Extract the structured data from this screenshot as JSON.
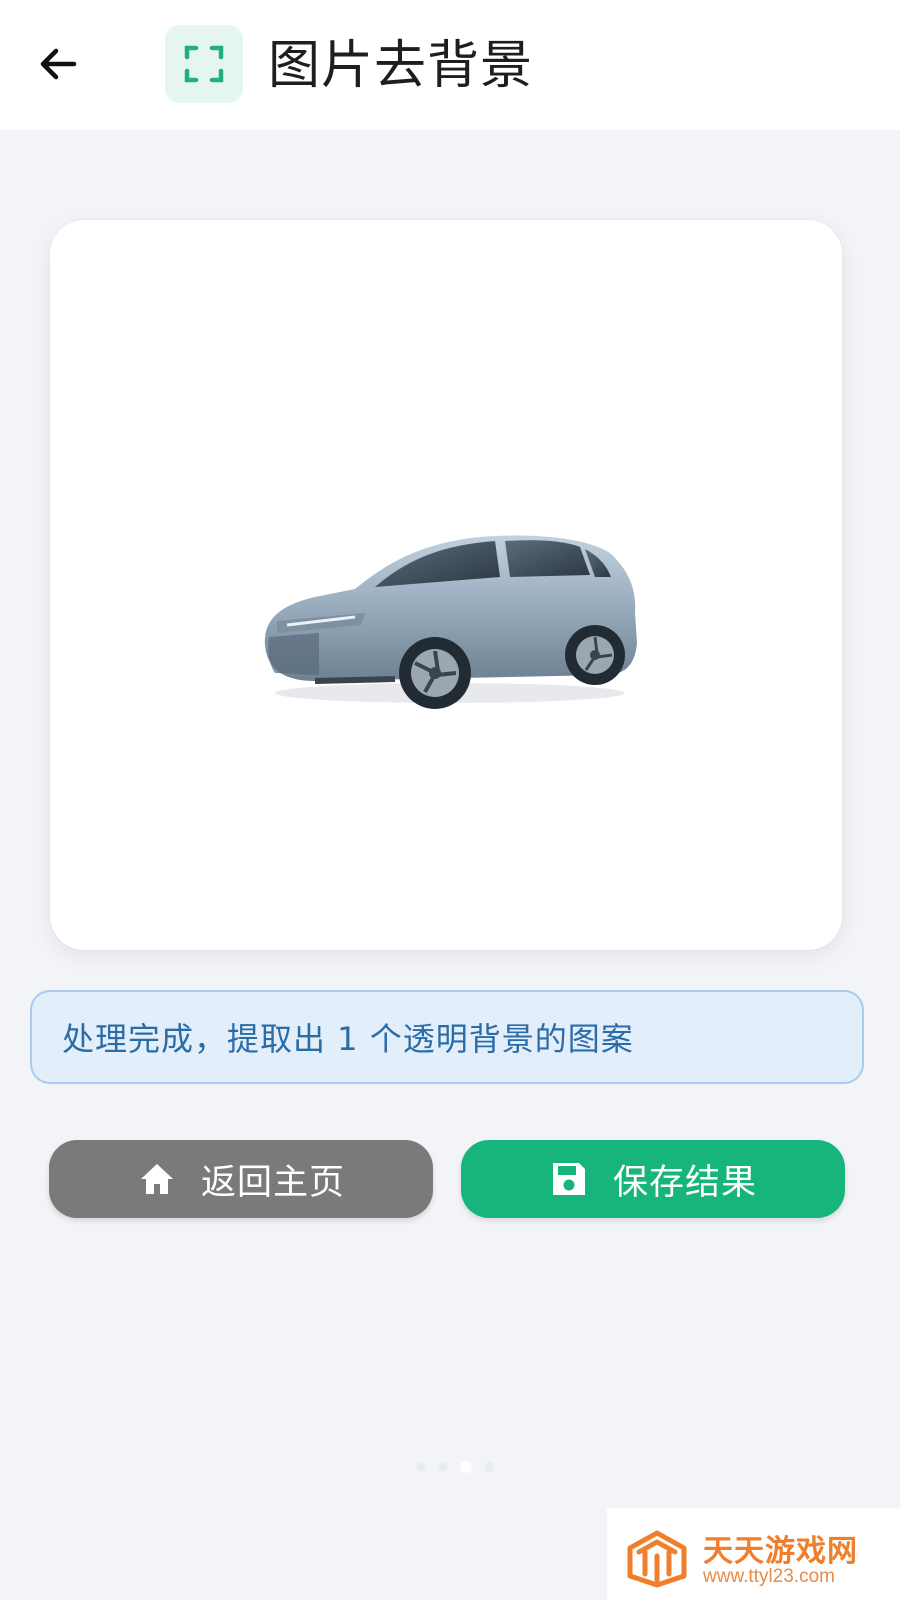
{
  "header": {
    "back_icon": "arrow-left-icon",
    "title_icon": "scan-frame-icon",
    "title": "图片去背景"
  },
  "preview": {
    "subject": "car-image"
  },
  "status": {
    "message": "处理完成，提取出 1 个透明背景的图案"
  },
  "actions": {
    "home_label": "返回主页",
    "home_icon": "home-icon",
    "save_label": "保存结果",
    "save_icon": "save-icon"
  },
  "pager": {
    "active_index": 2,
    "count": 4
  },
  "watermark": {
    "title": "天天游戏网",
    "url": "www.ttyl23.com"
  },
  "colors": {
    "accent": "#17b57b",
    "secondary_button": "#7a7a7a",
    "banner_bg": "#e2effb",
    "banner_text": "#2c6ca6",
    "background": "#f2f4f8"
  }
}
